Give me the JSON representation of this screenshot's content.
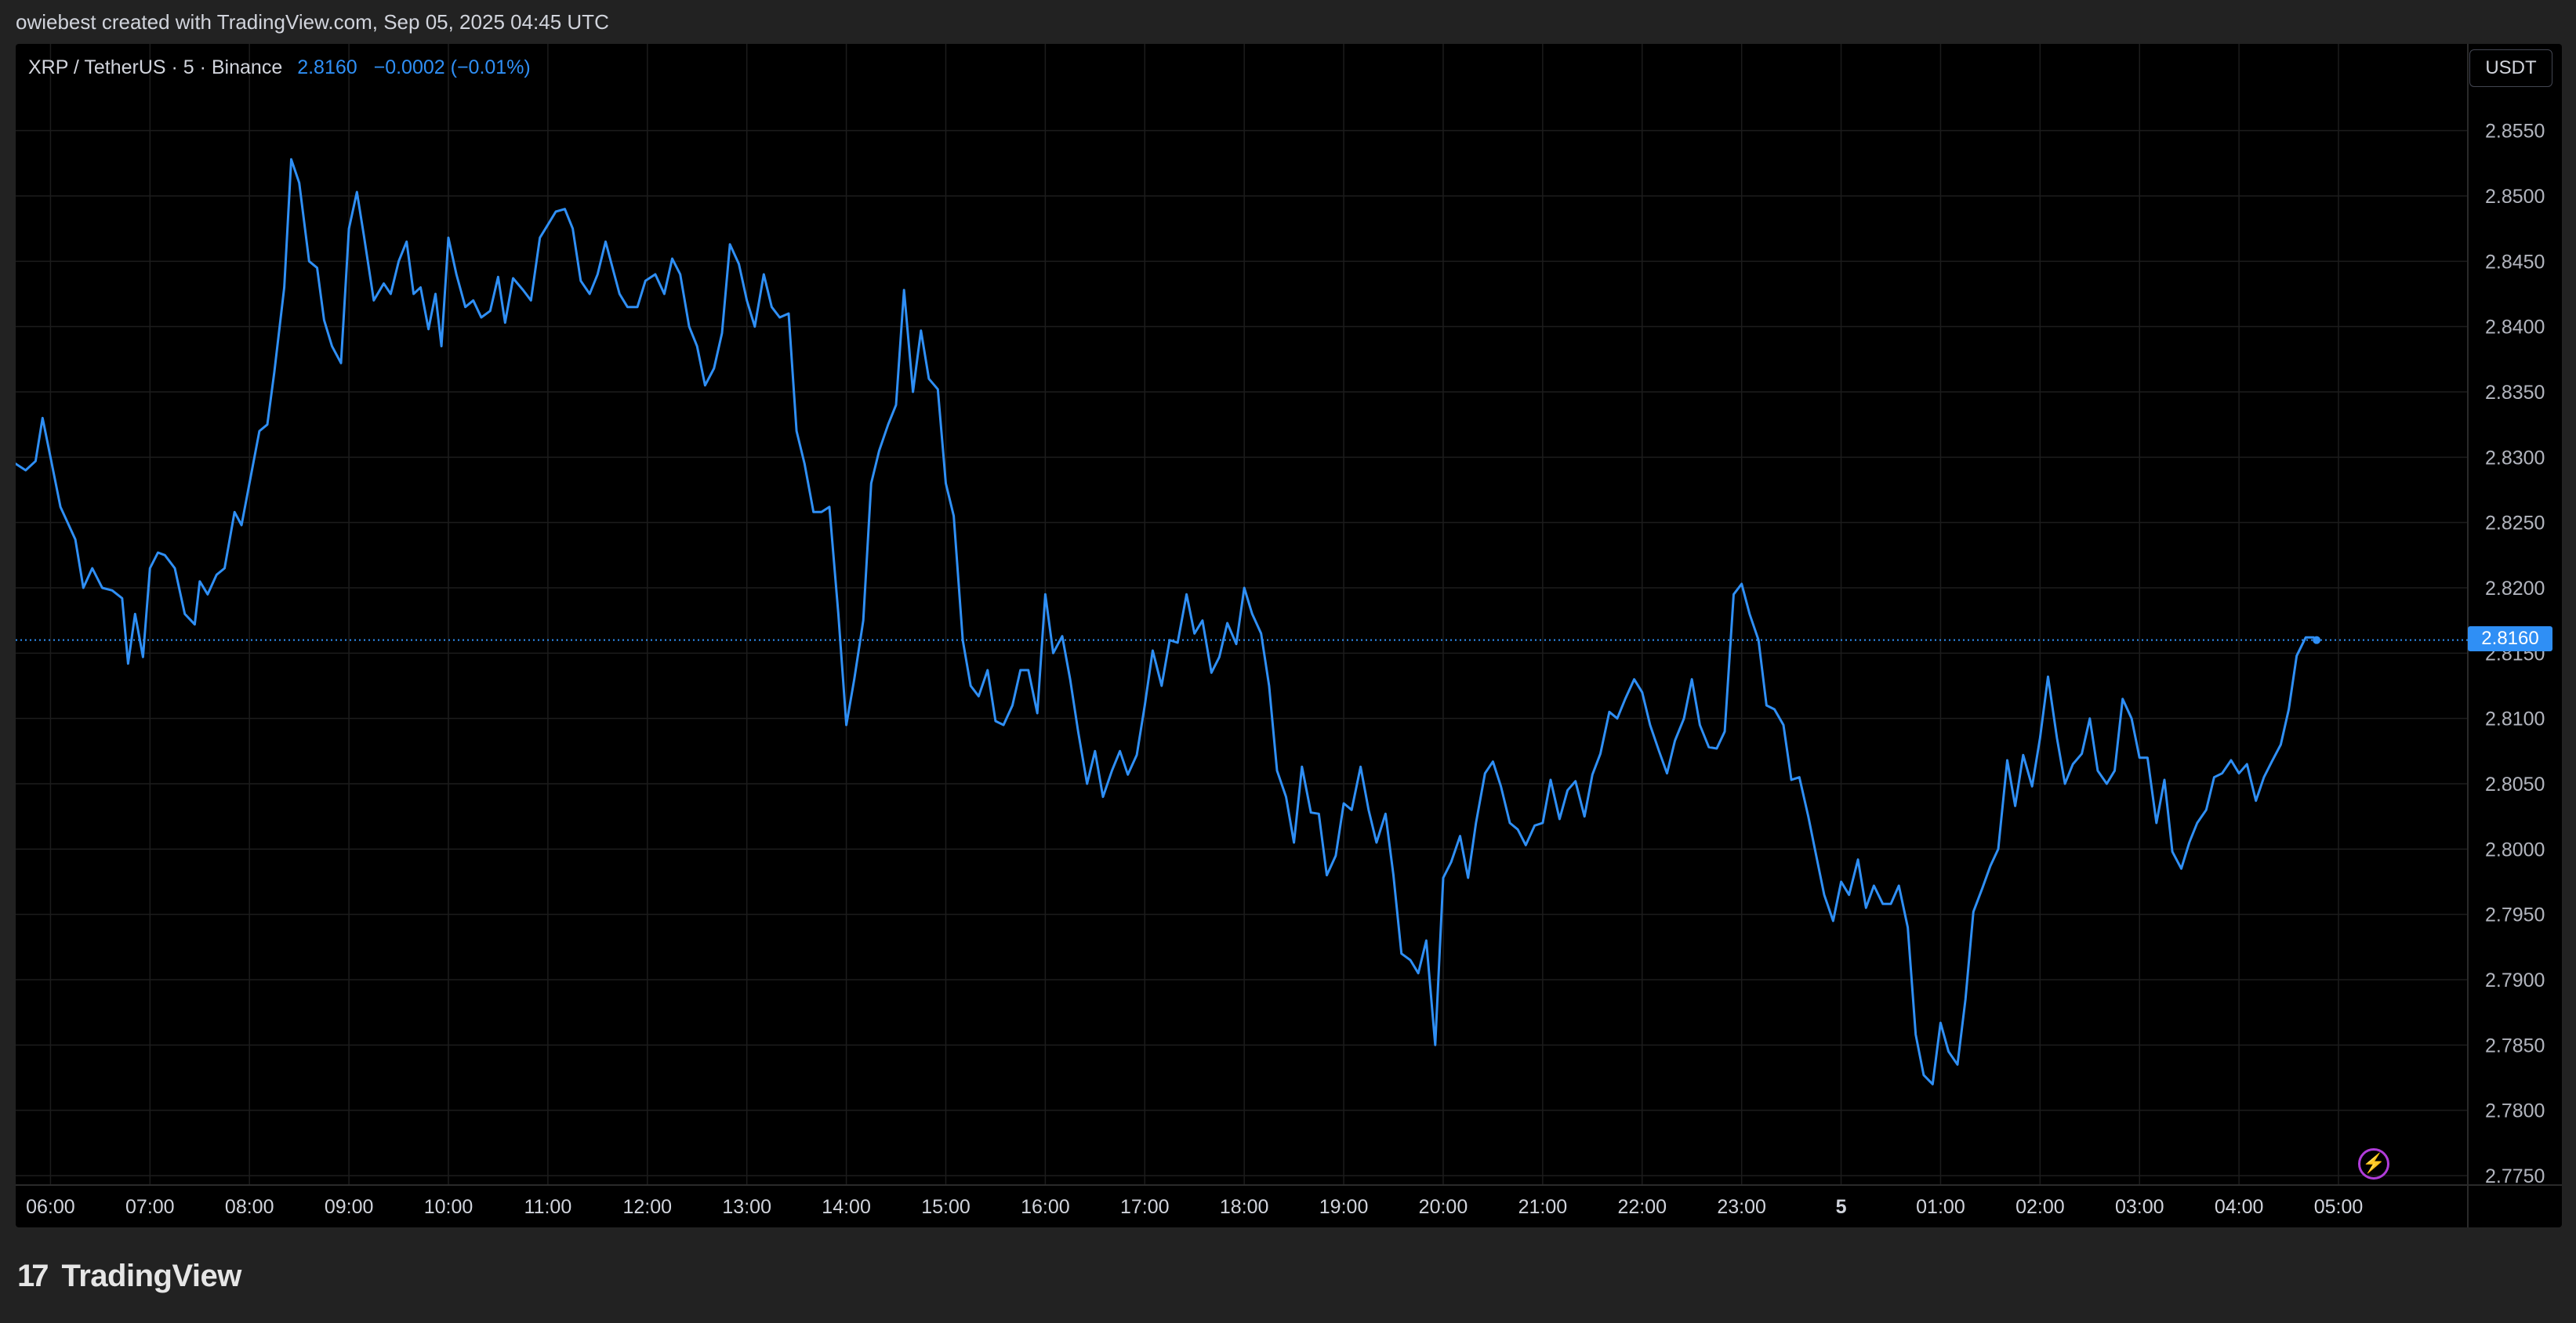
{
  "header": {
    "text": "owiebest created with TradingView.com, Sep 05, 2025 04:45 UTC"
  },
  "symbol": {
    "name": "XRP / TetherUS · 5 · Binance",
    "price": "2.8160",
    "change": "−0.0002 (−0.01%)"
  },
  "currency": "USDT",
  "last_price_label": "2.8160",
  "flash_icon_glyph": "⚡",
  "logo": {
    "mark": "17",
    "word": "TradingView"
  },
  "colors": {
    "line": "#2f8ff5",
    "background": "#000000",
    "grid": "#1c1c1c",
    "text": "#d1d4dc",
    "flash": "#b03cd9"
  },
  "chart_data": {
    "type": "line",
    "title": "",
    "xlabel": "",
    "ylabel": "",
    "ylim": [
      2.775,
      2.859
    ],
    "y_ticks": [
      "2.7750",
      "2.7800",
      "2.7850",
      "2.7900",
      "2.7950",
      "2.8000",
      "2.8050",
      "2.8100",
      "2.8150",
      "2.8200",
      "2.8250",
      "2.8300",
      "2.8350",
      "2.8400",
      "2.8450",
      "2.8500",
      "2.8550"
    ],
    "x_ticks": [
      {
        "label": "06:00",
        "h": 0
      },
      {
        "label": "07:00",
        "h": 1
      },
      {
        "label": "08:00",
        "h": 2
      },
      {
        "label": "09:00",
        "h": 3
      },
      {
        "label": "10:00",
        "h": 4
      },
      {
        "label": "11:00",
        "h": 5
      },
      {
        "label": "12:00",
        "h": 6
      },
      {
        "label": "13:00",
        "h": 7
      },
      {
        "label": "14:00",
        "h": 8
      },
      {
        "label": "15:00",
        "h": 9
      },
      {
        "label": "16:00",
        "h": 10
      },
      {
        "label": "17:00",
        "h": 11
      },
      {
        "label": "18:00",
        "h": 12
      },
      {
        "label": "19:00",
        "h": 13
      },
      {
        "label": "20:00",
        "h": 14
      },
      {
        "label": "21:00",
        "h": 15
      },
      {
        "label": "22:00",
        "h": 16
      },
      {
        "label": "23:00",
        "h": 17
      },
      {
        "label": "5",
        "h": 18,
        "bold": true
      },
      {
        "label": "01:00",
        "h": 19
      },
      {
        "label": "02:00",
        "h": 20
      },
      {
        "label": "03:00",
        "h": 21
      },
      {
        "label": "04:00",
        "h": 22
      },
      {
        "label": "05:00",
        "h": 23
      }
    ],
    "x_range_hours": [
      -0.35,
      24.3
    ],
    "last_value": 2.816,
    "grid": true,
    "series": [
      {
        "points": [
          [
            -0.35,
            2.8295
          ],
          [
            -0.25,
            2.829
          ],
          [
            -0.15,
            2.8297
          ],
          [
            -0.08,
            2.833
          ],
          [
            0.0,
            2.83
          ],
          [
            0.1,
            2.8262
          ],
          [
            0.25,
            2.8237
          ],
          [
            0.33,
            2.82
          ],
          [
            0.42,
            2.8215
          ],
          [
            0.52,
            2.82
          ],
          [
            0.62,
            2.8198
          ],
          [
            0.72,
            2.8192
          ],
          [
            0.78,
            2.8142
          ],
          [
            0.85,
            2.818
          ],
          [
            0.93,
            2.8147
          ],
          [
            1.0,
            2.8215
          ],
          [
            1.08,
            2.8227
          ],
          [
            1.15,
            2.8225
          ],
          [
            1.25,
            2.8215
          ],
          [
            1.35,
            2.818
          ],
          [
            1.45,
            2.8172
          ],
          [
            1.5,
            2.8205
          ],
          [
            1.58,
            2.8195
          ],
          [
            1.67,
            2.821
          ],
          [
            1.75,
            2.8215
          ],
          [
            1.85,
            2.8258
          ],
          [
            1.92,
            2.8248
          ],
          [
            2.0,
            2.828
          ],
          [
            2.1,
            2.832
          ],
          [
            2.18,
            2.8325
          ],
          [
            2.25,
            2.8365
          ],
          [
            2.35,
            2.843
          ],
          [
            2.42,
            2.8528
          ],
          [
            2.5,
            2.851
          ],
          [
            2.6,
            2.845
          ],
          [
            2.68,
            2.8445
          ],
          [
            2.75,
            2.8405
          ],
          [
            2.83,
            2.8385
          ],
          [
            2.92,
            2.8372
          ],
          [
            3.0,
            2.8475
          ],
          [
            3.08,
            2.8503
          ],
          [
            3.15,
            2.847
          ],
          [
            3.25,
            2.842
          ],
          [
            3.35,
            2.8433
          ],
          [
            3.42,
            2.8425
          ],
          [
            3.5,
            2.845
          ],
          [
            3.58,
            2.8465
          ],
          [
            3.65,
            2.8425
          ],
          [
            3.72,
            2.843
          ],
          [
            3.8,
            2.8398
          ],
          [
            3.87,
            2.8425
          ],
          [
            3.93,
            2.8385
          ],
          [
            4.0,
            2.8468
          ],
          [
            4.08,
            2.844
          ],
          [
            4.17,
            2.8415
          ],
          [
            4.25,
            2.842
          ],
          [
            4.33,
            2.8407
          ],
          [
            4.42,
            2.8412
          ],
          [
            4.5,
            2.8438
          ],
          [
            4.57,
            2.8403
          ],
          [
            4.65,
            2.8437
          ],
          [
            4.75,
            2.8428
          ],
          [
            4.83,
            2.842
          ],
          [
            4.92,
            2.8468
          ],
          [
            5.0,
            2.8478
          ],
          [
            5.08,
            2.8488
          ],
          [
            5.17,
            2.849
          ],
          [
            5.25,
            2.8475
          ],
          [
            5.33,
            2.8435
          ],
          [
            5.42,
            2.8425
          ],
          [
            5.5,
            2.844
          ],
          [
            5.58,
            2.8465
          ],
          [
            5.65,
            2.8445
          ],
          [
            5.72,
            2.8425
          ],
          [
            5.8,
            2.8415
          ],
          [
            5.9,
            2.8415
          ],
          [
            5.98,
            2.8435
          ],
          [
            6.08,
            2.844
          ],
          [
            6.17,
            2.8425
          ],
          [
            6.25,
            2.8452
          ],
          [
            6.33,
            2.844
          ],
          [
            6.42,
            2.84
          ],
          [
            6.5,
            2.8385
          ],
          [
            6.58,
            2.8355
          ],
          [
            6.67,
            2.8368
          ],
          [
            6.75,
            2.8395
          ],
          [
            6.83,
            2.8463
          ],
          [
            6.92,
            2.8448
          ],
          [
            7.0,
            2.842
          ],
          [
            7.08,
            2.84
          ],
          [
            7.17,
            2.844
          ],
          [
            7.25,
            2.8415
          ],
          [
            7.33,
            2.8407
          ],
          [
            7.42,
            2.841
          ],
          [
            7.5,
            2.832
          ],
          [
            7.58,
            2.8295
          ],
          [
            7.67,
            2.8258
          ],
          [
            7.75,
            2.8258
          ],
          [
            7.83,
            2.8262
          ],
          [
            7.92,
            2.818
          ],
          [
            8.0,
            2.8095
          ],
          [
            8.08,
            2.813
          ],
          [
            8.17,
            2.8175
          ],
          [
            8.25,
            2.828
          ],
          [
            8.33,
            2.8305
          ],
          [
            8.42,
            2.8325
          ],
          [
            8.5,
            2.834
          ],
          [
            8.58,
            2.8428
          ],
          [
            8.67,
            2.835
          ],
          [
            8.75,
            2.8397
          ],
          [
            8.83,
            2.836
          ],
          [
            8.92,
            2.8352
          ],
          [
            9.0,
            2.828
          ],
          [
            9.08,
            2.8255
          ],
          [
            9.17,
            2.816
          ],
          [
            9.25,
            2.8125
          ],
          [
            9.33,
            2.8117
          ],
          [
            9.42,
            2.8137
          ],
          [
            9.5,
            2.8098
          ],
          [
            9.58,
            2.8095
          ],
          [
            9.67,
            2.811
          ],
          [
            9.75,
            2.8137
          ],
          [
            9.83,
            2.8137
          ],
          [
            9.92,
            2.8104
          ],
          [
            10.0,
            2.8195
          ],
          [
            10.08,
            2.815
          ],
          [
            10.17,
            2.8163
          ],
          [
            10.25,
            2.813
          ],
          [
            10.33,
            2.809
          ],
          [
            10.42,
            2.805
          ],
          [
            10.5,
            2.8075
          ],
          [
            10.58,
            2.804
          ],
          [
            10.67,
            2.806
          ],
          [
            10.75,
            2.8075
          ],
          [
            10.83,
            2.8057
          ],
          [
            10.92,
            2.8072
          ],
          [
            11.0,
            2.811
          ],
          [
            11.08,
            2.8152
          ],
          [
            11.17,
            2.8125
          ],
          [
            11.25,
            2.816
          ],
          [
            11.33,
            2.8158
          ],
          [
            11.42,
            2.8195
          ],
          [
            11.5,
            2.8165
          ],
          [
            11.58,
            2.8175
          ],
          [
            11.67,
            2.8135
          ],
          [
            11.75,
            2.8147
          ],
          [
            11.83,
            2.8173
          ],
          [
            11.92,
            2.8157
          ],
          [
            12.0,
            2.82
          ],
          [
            12.08,
            2.818
          ],
          [
            12.17,
            2.8165
          ],
          [
            12.25,
            2.8125
          ],
          [
            12.33,
            2.806
          ],
          [
            12.42,
            2.804
          ],
          [
            12.5,
            2.8005
          ],
          [
            12.58,
            2.8063
          ],
          [
            12.67,
            2.8028
          ],
          [
            12.75,
            2.8027
          ],
          [
            12.83,
            2.798
          ],
          [
            12.92,
            2.7995
          ],
          [
            13.0,
            2.8035
          ],
          [
            13.08,
            2.803
          ],
          [
            13.17,
            2.8063
          ],
          [
            13.25,
            2.803
          ],
          [
            13.33,
            2.8005
          ],
          [
            13.42,
            2.8027
          ],
          [
            13.5,
            2.798
          ],
          [
            13.58,
            2.792
          ],
          [
            13.67,
            2.7915
          ],
          [
            13.75,
            2.7905
          ],
          [
            13.83,
            2.793
          ],
          [
            13.92,
            2.785
          ],
          [
            14.0,
            2.7978
          ],
          [
            14.08,
            2.799
          ],
          [
            14.17,
            2.801
          ],
          [
            14.25,
            2.7978
          ],
          [
            14.33,
            2.802
          ],
          [
            14.42,
            2.8058
          ],
          [
            14.5,
            2.8067
          ],
          [
            14.58,
            2.8048
          ],
          [
            14.67,
            2.802
          ],
          [
            14.75,
            2.8015
          ],
          [
            14.83,
            2.8003
          ],
          [
            14.92,
            2.8018
          ],
          [
            15.0,
            2.802
          ],
          [
            15.08,
            2.8053
          ],
          [
            15.17,
            2.8023
          ],
          [
            15.25,
            2.8045
          ],
          [
            15.33,
            2.8052
          ],
          [
            15.42,
            2.8025
          ],
          [
            15.5,
            2.8057
          ],
          [
            15.58,
            2.8073
          ],
          [
            15.67,
            2.8105
          ],
          [
            15.75,
            2.81
          ],
          [
            15.83,
            2.8115
          ],
          [
            15.92,
            2.813
          ],
          [
            16.0,
            2.812
          ],
          [
            16.08,
            2.8095
          ],
          [
            16.17,
            2.8075
          ],
          [
            16.25,
            2.8058
          ],
          [
            16.33,
            2.8083
          ],
          [
            16.42,
            2.81
          ],
          [
            16.5,
            2.813
          ],
          [
            16.58,
            2.8095
          ],
          [
            16.67,
            2.8078
          ],
          [
            16.75,
            2.8077
          ],
          [
            16.83,
            2.809
          ],
          [
            16.92,
            2.8195
          ],
          [
            17.0,
            2.8203
          ],
          [
            17.08,
            2.818
          ],
          [
            17.17,
            2.816
          ],
          [
            17.25,
            2.811
          ],
          [
            17.33,
            2.8107
          ],
          [
            17.42,
            2.8095
          ],
          [
            17.5,
            2.8053
          ],
          [
            17.58,
            2.8055
          ],
          [
            17.67,
            2.8025
          ],
          [
            17.75,
            2.7995
          ],
          [
            17.83,
            2.7965
          ],
          [
            17.92,
            2.7945
          ],
          [
            18.0,
            2.7975
          ],
          [
            18.08,
            2.7965
          ],
          [
            18.17,
            2.7992
          ],
          [
            18.25,
            2.7955
          ],
          [
            18.33,
            2.7972
          ],
          [
            18.42,
            2.7958
          ],
          [
            18.5,
            2.7958
          ],
          [
            18.58,
            2.7972
          ],
          [
            18.67,
            2.794
          ],
          [
            18.75,
            2.7858
          ],
          [
            18.83,
            2.7827
          ],
          [
            18.92,
            2.782
          ],
          [
            19.0,
            2.7867
          ],
          [
            19.08,
            2.7845
          ],
          [
            19.17,
            2.7835
          ],
          [
            19.25,
            2.7885
          ],
          [
            19.33,
            2.7952
          ],
          [
            19.42,
            2.797
          ],
          [
            19.5,
            2.7987
          ],
          [
            19.58,
            2.8
          ],
          [
            19.67,
            2.8068
          ],
          [
            19.75,
            2.8033
          ],
          [
            19.83,
            2.8072
          ],
          [
            19.92,
            2.8048
          ],
          [
            20.0,
            2.8085
          ],
          [
            20.08,
            2.8132
          ],
          [
            20.17,
            2.8085
          ],
          [
            20.25,
            2.805
          ],
          [
            20.33,
            2.8065
          ],
          [
            20.42,
            2.8073
          ],
          [
            20.5,
            2.81
          ],
          [
            20.58,
            2.806
          ],
          [
            20.67,
            2.805
          ],
          [
            20.75,
            2.806
          ],
          [
            20.83,
            2.8115
          ],
          [
            20.92,
            2.81
          ],
          [
            21.0,
            2.807
          ],
          [
            21.08,
            2.807
          ],
          [
            21.17,
            2.802
          ],
          [
            21.25,
            2.8053
          ],
          [
            21.33,
            2.7998
          ],
          [
            21.42,
            2.7985
          ],
          [
            21.5,
            2.8005
          ],
          [
            21.58,
            2.802
          ],
          [
            21.67,
            2.803
          ],
          [
            21.75,
            2.8055
          ],
          [
            21.83,
            2.8058
          ],
          [
            21.92,
            2.8068
          ],
          [
            22.0,
            2.8058
          ],
          [
            22.08,
            2.8065
          ],
          [
            22.17,
            2.8037
          ],
          [
            22.25,
            2.8055
          ],
          [
            22.33,
            2.8067
          ],
          [
            22.42,
            2.808
          ],
          [
            22.5,
            2.8107
          ],
          [
            22.58,
            2.8148
          ],
          [
            22.67,
            2.8162
          ],
          [
            22.75,
            2.8162
          ],
          [
            22.78,
            2.816
          ]
        ]
      }
    ]
  }
}
